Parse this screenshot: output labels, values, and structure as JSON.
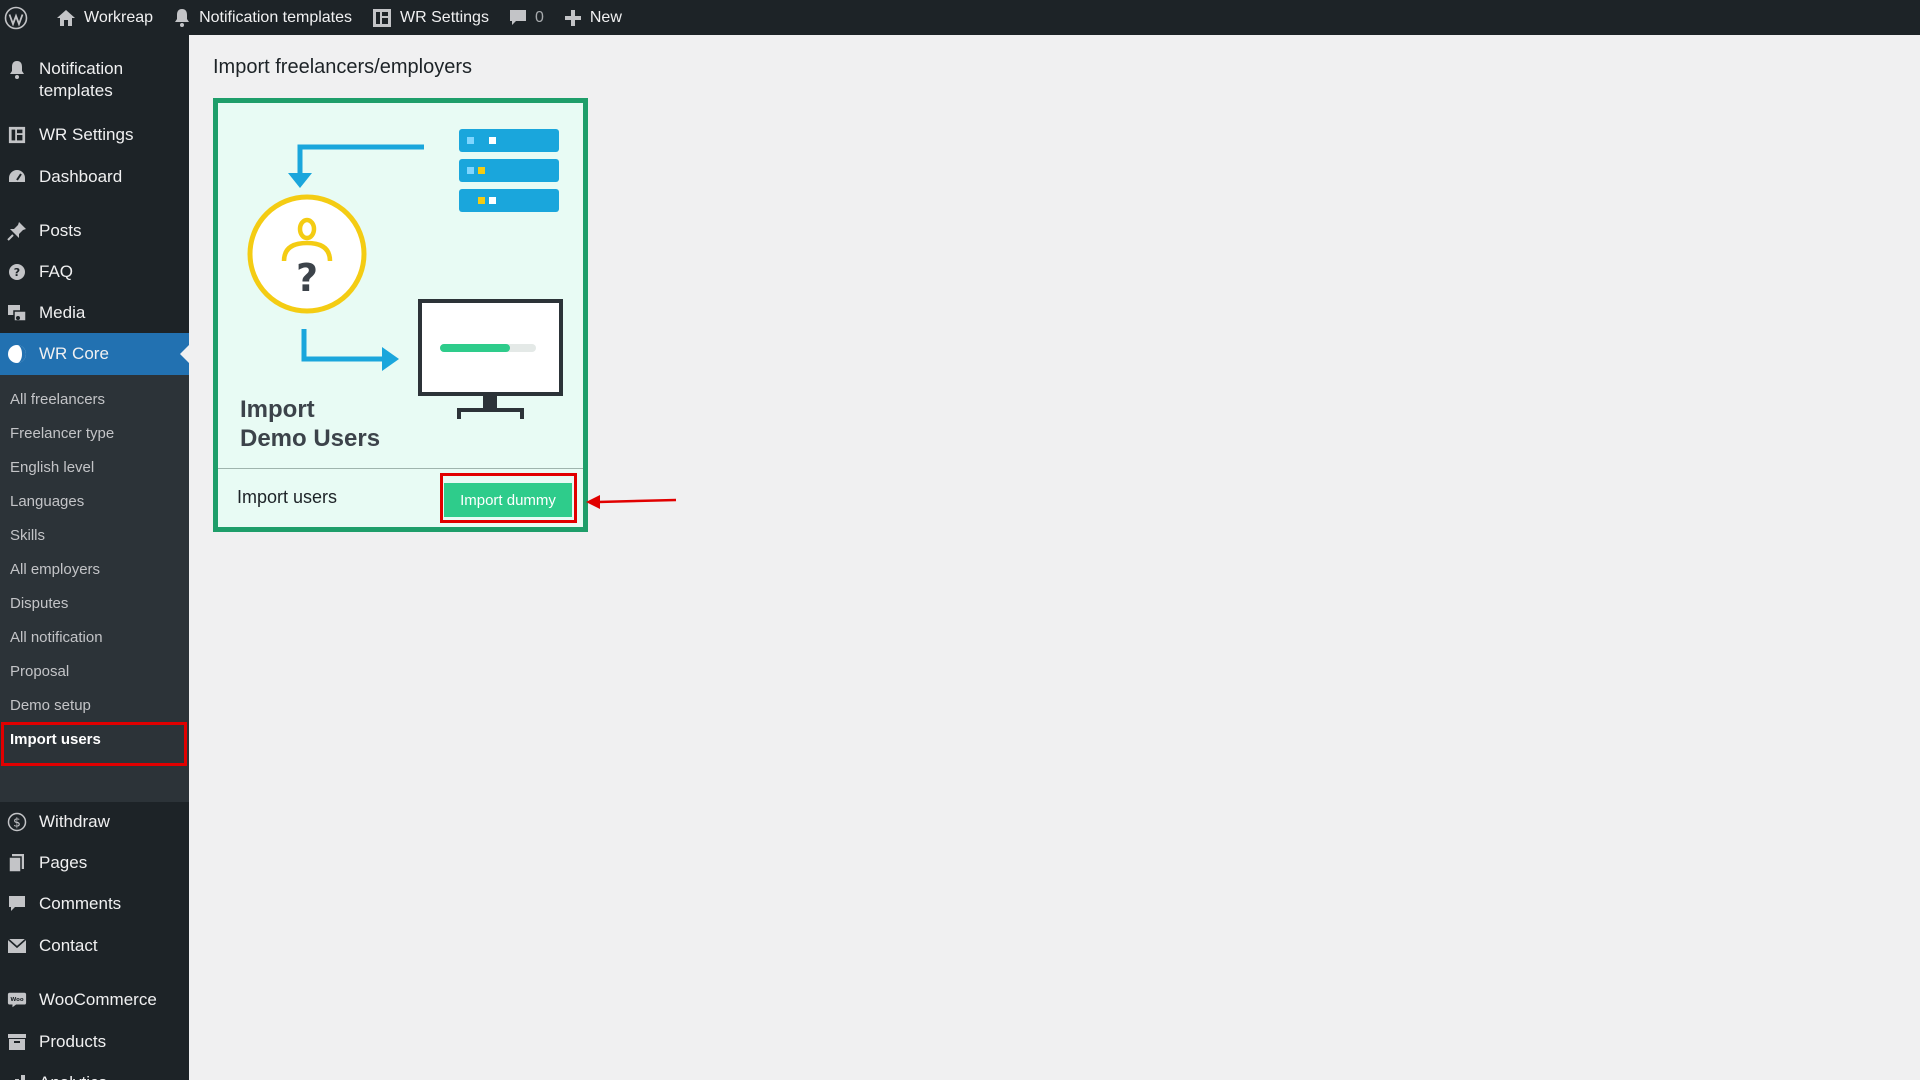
{
  "adminbar": {
    "site_name": "Workreap",
    "notification_templates": "Notification templates",
    "wr_settings": "WR Settings",
    "comments_count": "0",
    "new_label": "New"
  },
  "sidebar": {
    "items": [
      {
        "label": "Notification templates",
        "icon": "bell-icon"
      },
      {
        "label": "WR Settings",
        "icon": "settings-grid-icon"
      },
      {
        "label": "Dashboard",
        "icon": "dashboard-icon"
      },
      {
        "label": "Posts",
        "icon": "pin-icon"
      },
      {
        "label": "FAQ",
        "icon": "question-circle-icon"
      },
      {
        "label": "Media",
        "icon": "media-icon"
      },
      {
        "label": "WR Core",
        "icon": "wr-core-icon"
      },
      {
        "label": "Withdraw",
        "icon": "dollar-icon"
      },
      {
        "label": "Pages",
        "icon": "pages-icon"
      },
      {
        "label": "Comments",
        "icon": "comment-icon"
      },
      {
        "label": "Contact",
        "icon": "mail-icon"
      },
      {
        "label": "WooCommerce",
        "icon": "woo-icon"
      },
      {
        "label": "Products",
        "icon": "archive-icon"
      },
      {
        "label": "Analytics",
        "icon": "bar-chart-icon"
      }
    ],
    "notification_line1": "Notification",
    "notification_line2": "templates",
    "submenu": [
      "All freelancers",
      "Freelancer type",
      "English level",
      "Languages",
      "Skills",
      "All employers",
      "Disputes",
      "All notification",
      "Proposal",
      "Demo setup",
      "Import users"
    ]
  },
  "main": {
    "heading": "Import freelancers/employers",
    "card": {
      "art_title_line1": "Import",
      "art_title_line2": "Demo Users",
      "footer_label": "Import users",
      "button_label": "Import dummy"
    }
  },
  "colors": {
    "admin_dark": "#1d2327",
    "submenu_bg": "#2c3338",
    "accent_blue": "#2271b1",
    "card_border": "#1e9e6a",
    "card_bg": "#e8fbf4",
    "button_green": "#2ecc8b",
    "highlight_red": "#e10000",
    "art_blue": "#1aa6dc",
    "art_yellow": "#f4cc13"
  }
}
